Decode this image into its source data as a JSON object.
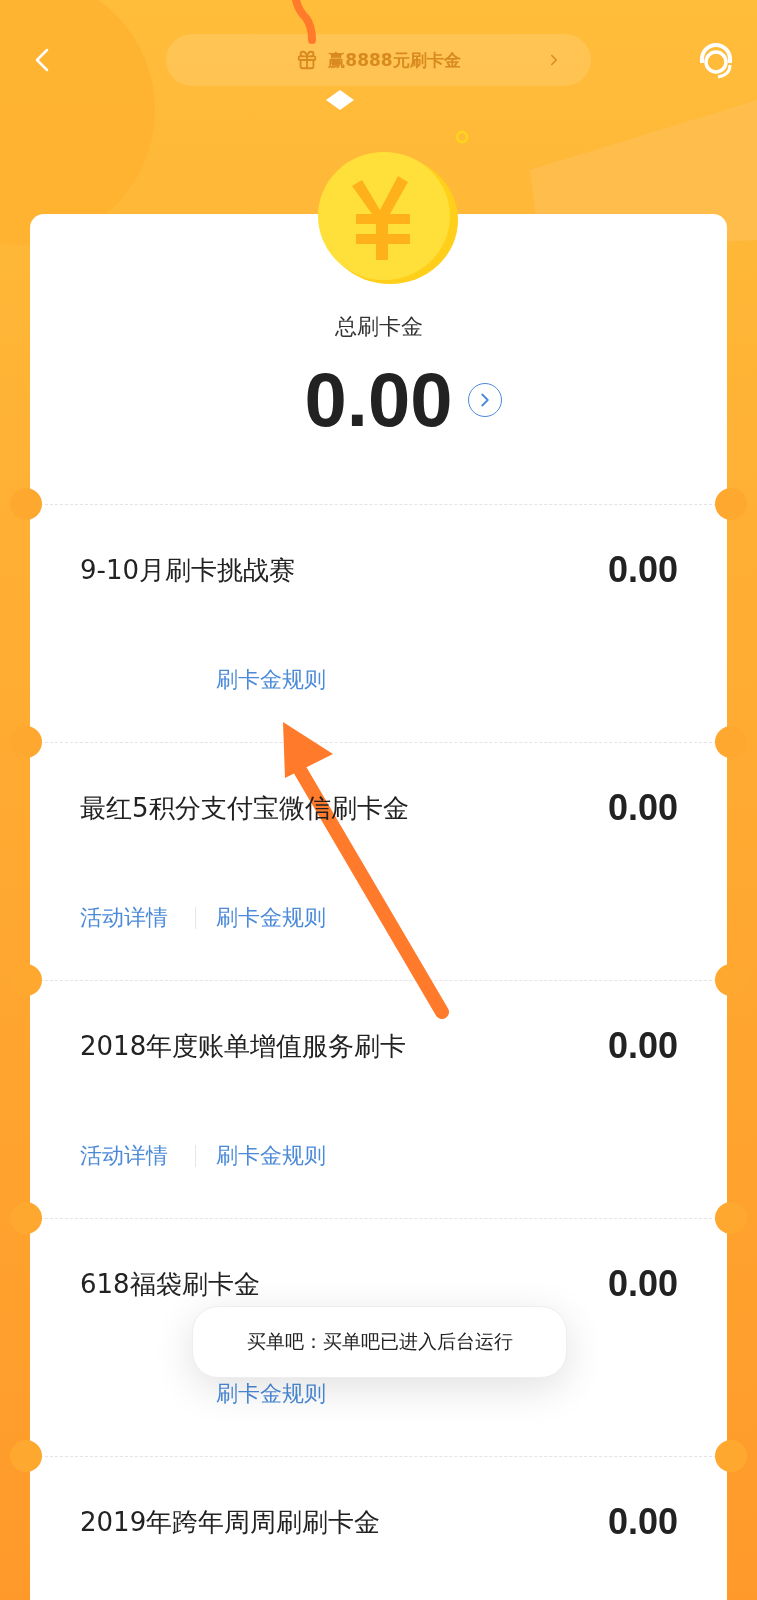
{
  "header": {
    "banner": "赢8888元刷卡金"
  },
  "summary": {
    "label": "总刷卡金",
    "amount": "0.00"
  },
  "rows": [
    {
      "title": "9-10月刷卡挑战赛",
      "amount": "0.00",
      "links": [
        {
          "kind": "rules",
          "label": "刷卡金规则"
        }
      ]
    },
    {
      "title": "最红5积分支付宝微信刷卡金",
      "amount": "0.00",
      "links": [
        {
          "kind": "detail",
          "label": "活动详情"
        },
        {
          "kind": "rules",
          "label": "刷卡金规则"
        }
      ]
    },
    {
      "title": "2018年度账单增值服务刷卡",
      "amount": "0.00",
      "links": [
        {
          "kind": "detail",
          "label": "活动详情"
        },
        {
          "kind": "rules",
          "label": "刷卡金规则"
        }
      ]
    },
    {
      "title": "618福袋刷卡金",
      "amount": "0.00",
      "links": [
        {
          "kind": "rules",
          "label": "刷卡金规则"
        }
      ]
    },
    {
      "title": "2019年跨年周周刷刷卡金",
      "amount": "0.00",
      "links": []
    }
  ],
  "toast": {
    "text": "买单吧：买单吧已进入后台运行"
  }
}
